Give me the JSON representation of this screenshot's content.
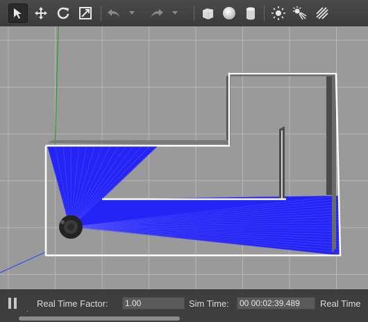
{
  "toolbar": {
    "tools": [
      {
        "id": "select",
        "icon": "arrow-cursor-icon"
      },
      {
        "id": "translate",
        "icon": "move-arrows-icon"
      },
      {
        "id": "rotate",
        "icon": "rotate-icon"
      },
      {
        "id": "scale",
        "icon": "scale-icon"
      },
      {
        "id": "undo",
        "icon": "undo-icon"
      },
      {
        "id": "redo",
        "icon": "redo-icon"
      },
      {
        "id": "box",
        "icon": "box-shape-icon"
      },
      {
        "id": "sphere",
        "icon": "sphere-shape-icon"
      },
      {
        "id": "cylinder",
        "icon": "cylinder-shape-icon"
      },
      {
        "id": "point-light",
        "icon": "point-light-icon"
      },
      {
        "id": "spot-light",
        "icon": "spot-light-icon"
      },
      {
        "id": "directional-light",
        "icon": "directional-light-icon"
      }
    ],
    "active_tool": "select"
  },
  "status": {
    "real_time_factor_label": "Real Time Factor:",
    "real_time_factor_value": "1.00",
    "sim_time_label": "Sim Time:",
    "sim_time_value": "00 00:02:39.489",
    "real_time_label": "Real Time"
  },
  "colors": {
    "laser": "#1a1aff",
    "ground": "#9a9a9a",
    "grid": "#b6b6b6",
    "wall_outline": "#ffffff",
    "axis_y": "#1fa81f",
    "axis_x": "#2a4cff"
  }
}
